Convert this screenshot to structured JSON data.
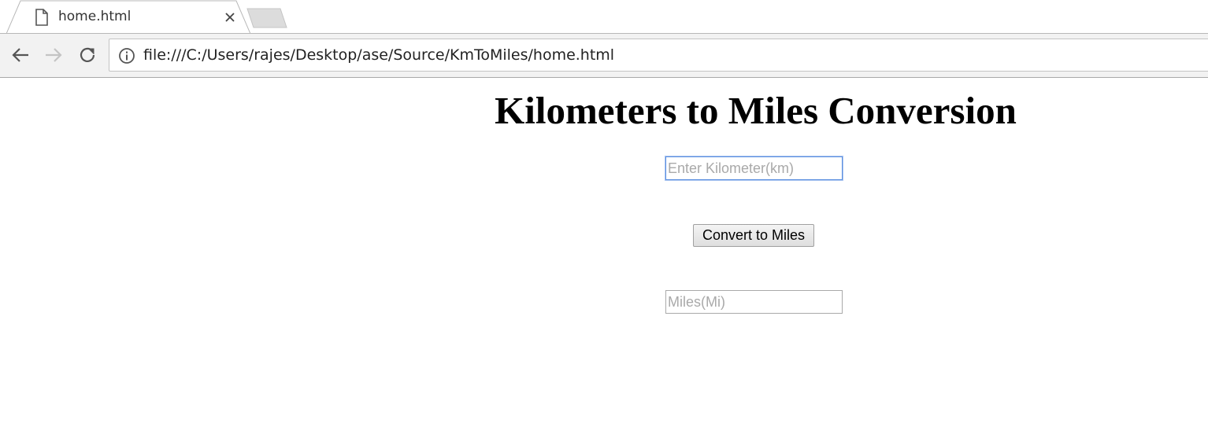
{
  "browser": {
    "tab": {
      "title": "home.html",
      "icon": "page-icon"
    },
    "toolbar": {
      "url": "file:///C:/Users/rajes/Desktop/ase/Source/KmToMiles/home.html"
    }
  },
  "page": {
    "heading": "Kilometers to Miles Conversion",
    "km_input": {
      "placeholder": "Enter Kilometer(km)",
      "value": ""
    },
    "convert_button": {
      "label": "Convert to Miles"
    },
    "miles_output": {
      "placeholder": "Miles(Mi)",
      "value": ""
    }
  }
}
